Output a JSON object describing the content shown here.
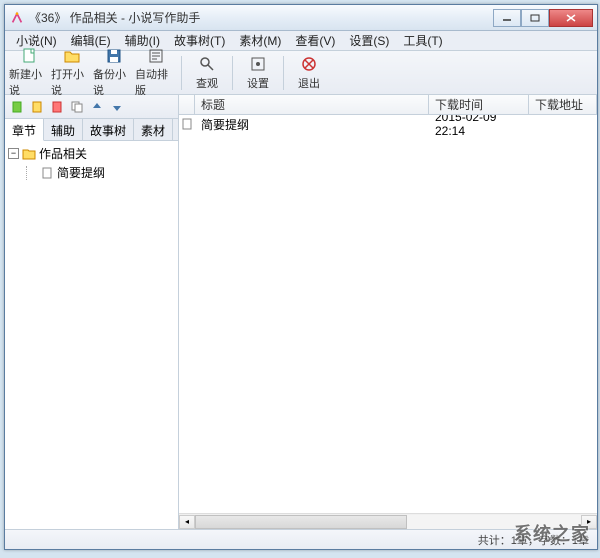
{
  "titlebar": {
    "title": "《36》 作品相关 - 小说写作助手"
  },
  "menubar": {
    "items": [
      {
        "label": "小说(N)"
      },
      {
        "label": "编辑(E)"
      },
      {
        "label": "辅助(I)"
      },
      {
        "label": "故事树(T)"
      },
      {
        "label": "素材(M)"
      },
      {
        "label": "查看(V)"
      },
      {
        "label": "设置(S)"
      },
      {
        "label": "工具(T)"
      }
    ]
  },
  "toolbar": {
    "buttons": [
      {
        "label": "新建小说",
        "icon": "file-new-icon"
      },
      {
        "label": "打开小说",
        "icon": "folder-open-icon"
      },
      {
        "label": "备份小说",
        "icon": "save-icon"
      },
      {
        "label": "自动排版",
        "icon": "layout-icon"
      }
    ],
    "buttons2": [
      {
        "label": "查观",
        "icon": "search-icon"
      }
    ],
    "buttons3": [
      {
        "label": "设置",
        "icon": "settings-icon"
      }
    ],
    "buttons4": [
      {
        "label": "退出",
        "icon": "exit-icon"
      }
    ]
  },
  "left_panel": {
    "toolbar_icons": [
      "add-icon",
      "edit-icon",
      "delete-icon",
      "copy-icon",
      "up-icon",
      "down-icon"
    ],
    "tabs": [
      {
        "label": "章节",
        "active": true
      },
      {
        "label": "辅助",
        "active": false
      },
      {
        "label": "故事树",
        "active": false
      },
      {
        "label": "素材",
        "active": false
      }
    ],
    "tree": {
      "root": {
        "label": "作品相关",
        "expanded": true
      },
      "children": [
        {
          "label": "简要提纲"
        }
      ]
    }
  },
  "list": {
    "columns": {
      "c1": "标题",
      "c2": "下载时间",
      "c3": "下载地址"
    },
    "rows": [
      {
        "title": "简要提纲",
        "time": "2015-02-09 22:14",
        "url": ""
      }
    ]
  },
  "statusbar": {
    "text": "共计：1章，字数：1章"
  },
  "watermark": "系统之家"
}
